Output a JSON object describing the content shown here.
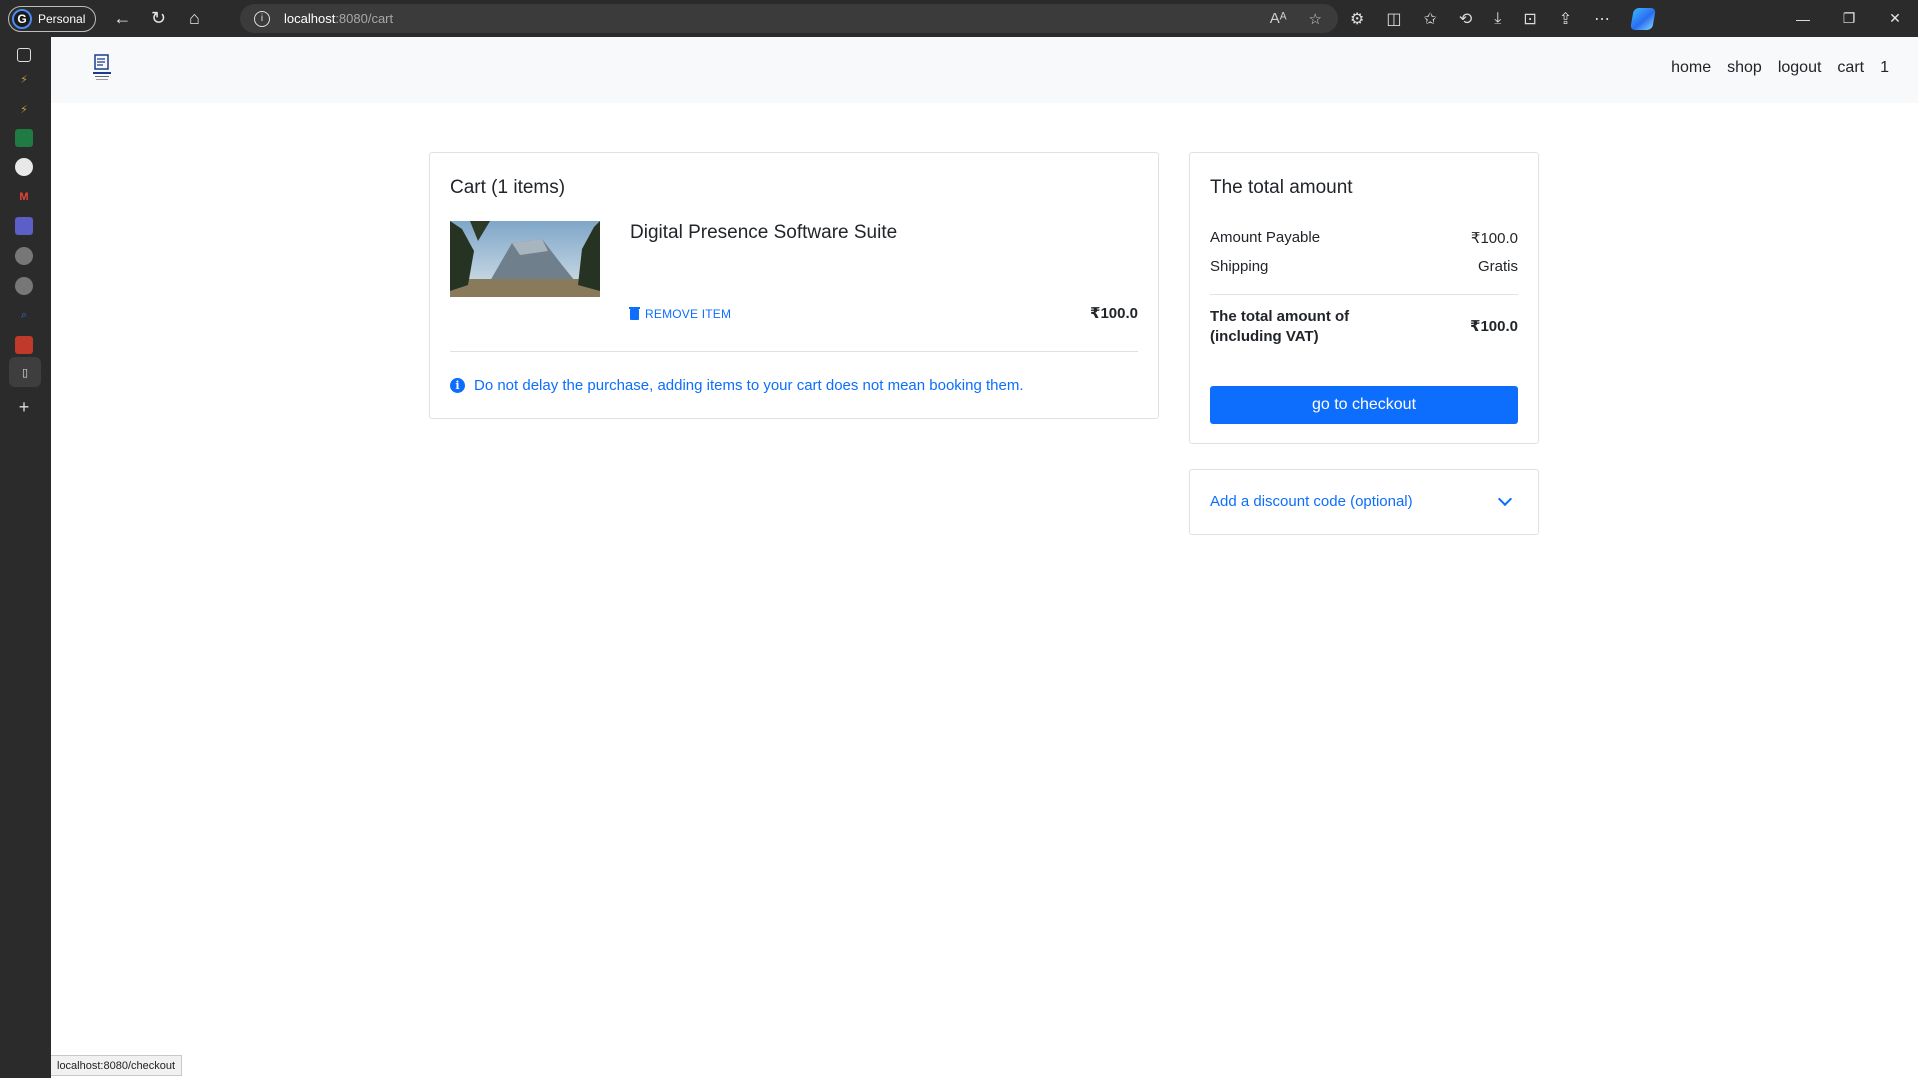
{
  "browser": {
    "profile_label": "Personal",
    "profile_initial": "G",
    "url_host": "localhost",
    "url_path": ":8080/cart",
    "status_url": "localhost:8080/checkout"
  },
  "site_nav": {
    "links": [
      "home",
      "shop",
      "logout",
      "cart",
      "1"
    ]
  },
  "cart": {
    "title": "Cart (1 items)",
    "item": {
      "name": "Digital Presence Software Suite",
      "remove_label": "REMOVE ITEM",
      "price": "₹100.0"
    },
    "notice": "Do not delay the purchase, adding items to your cart does not mean booking them."
  },
  "summary": {
    "title": "The total amount",
    "amount_payable_label": "Amount Payable",
    "amount_payable_value": "₹100.0",
    "shipping_label": "Shipping",
    "shipping_value": "Gratis",
    "total_label_line1": "The total amount of",
    "total_label_line2": "(including VAT)",
    "total_value": "₹100.0",
    "checkout_label": "go to checkout"
  },
  "discount": {
    "label": "Add a discount code (optional)"
  },
  "colors": {
    "primary": "#0d6efd",
    "navbar_bg": "#f8f9fa",
    "browser_chrome": "#2b2b2b"
  }
}
